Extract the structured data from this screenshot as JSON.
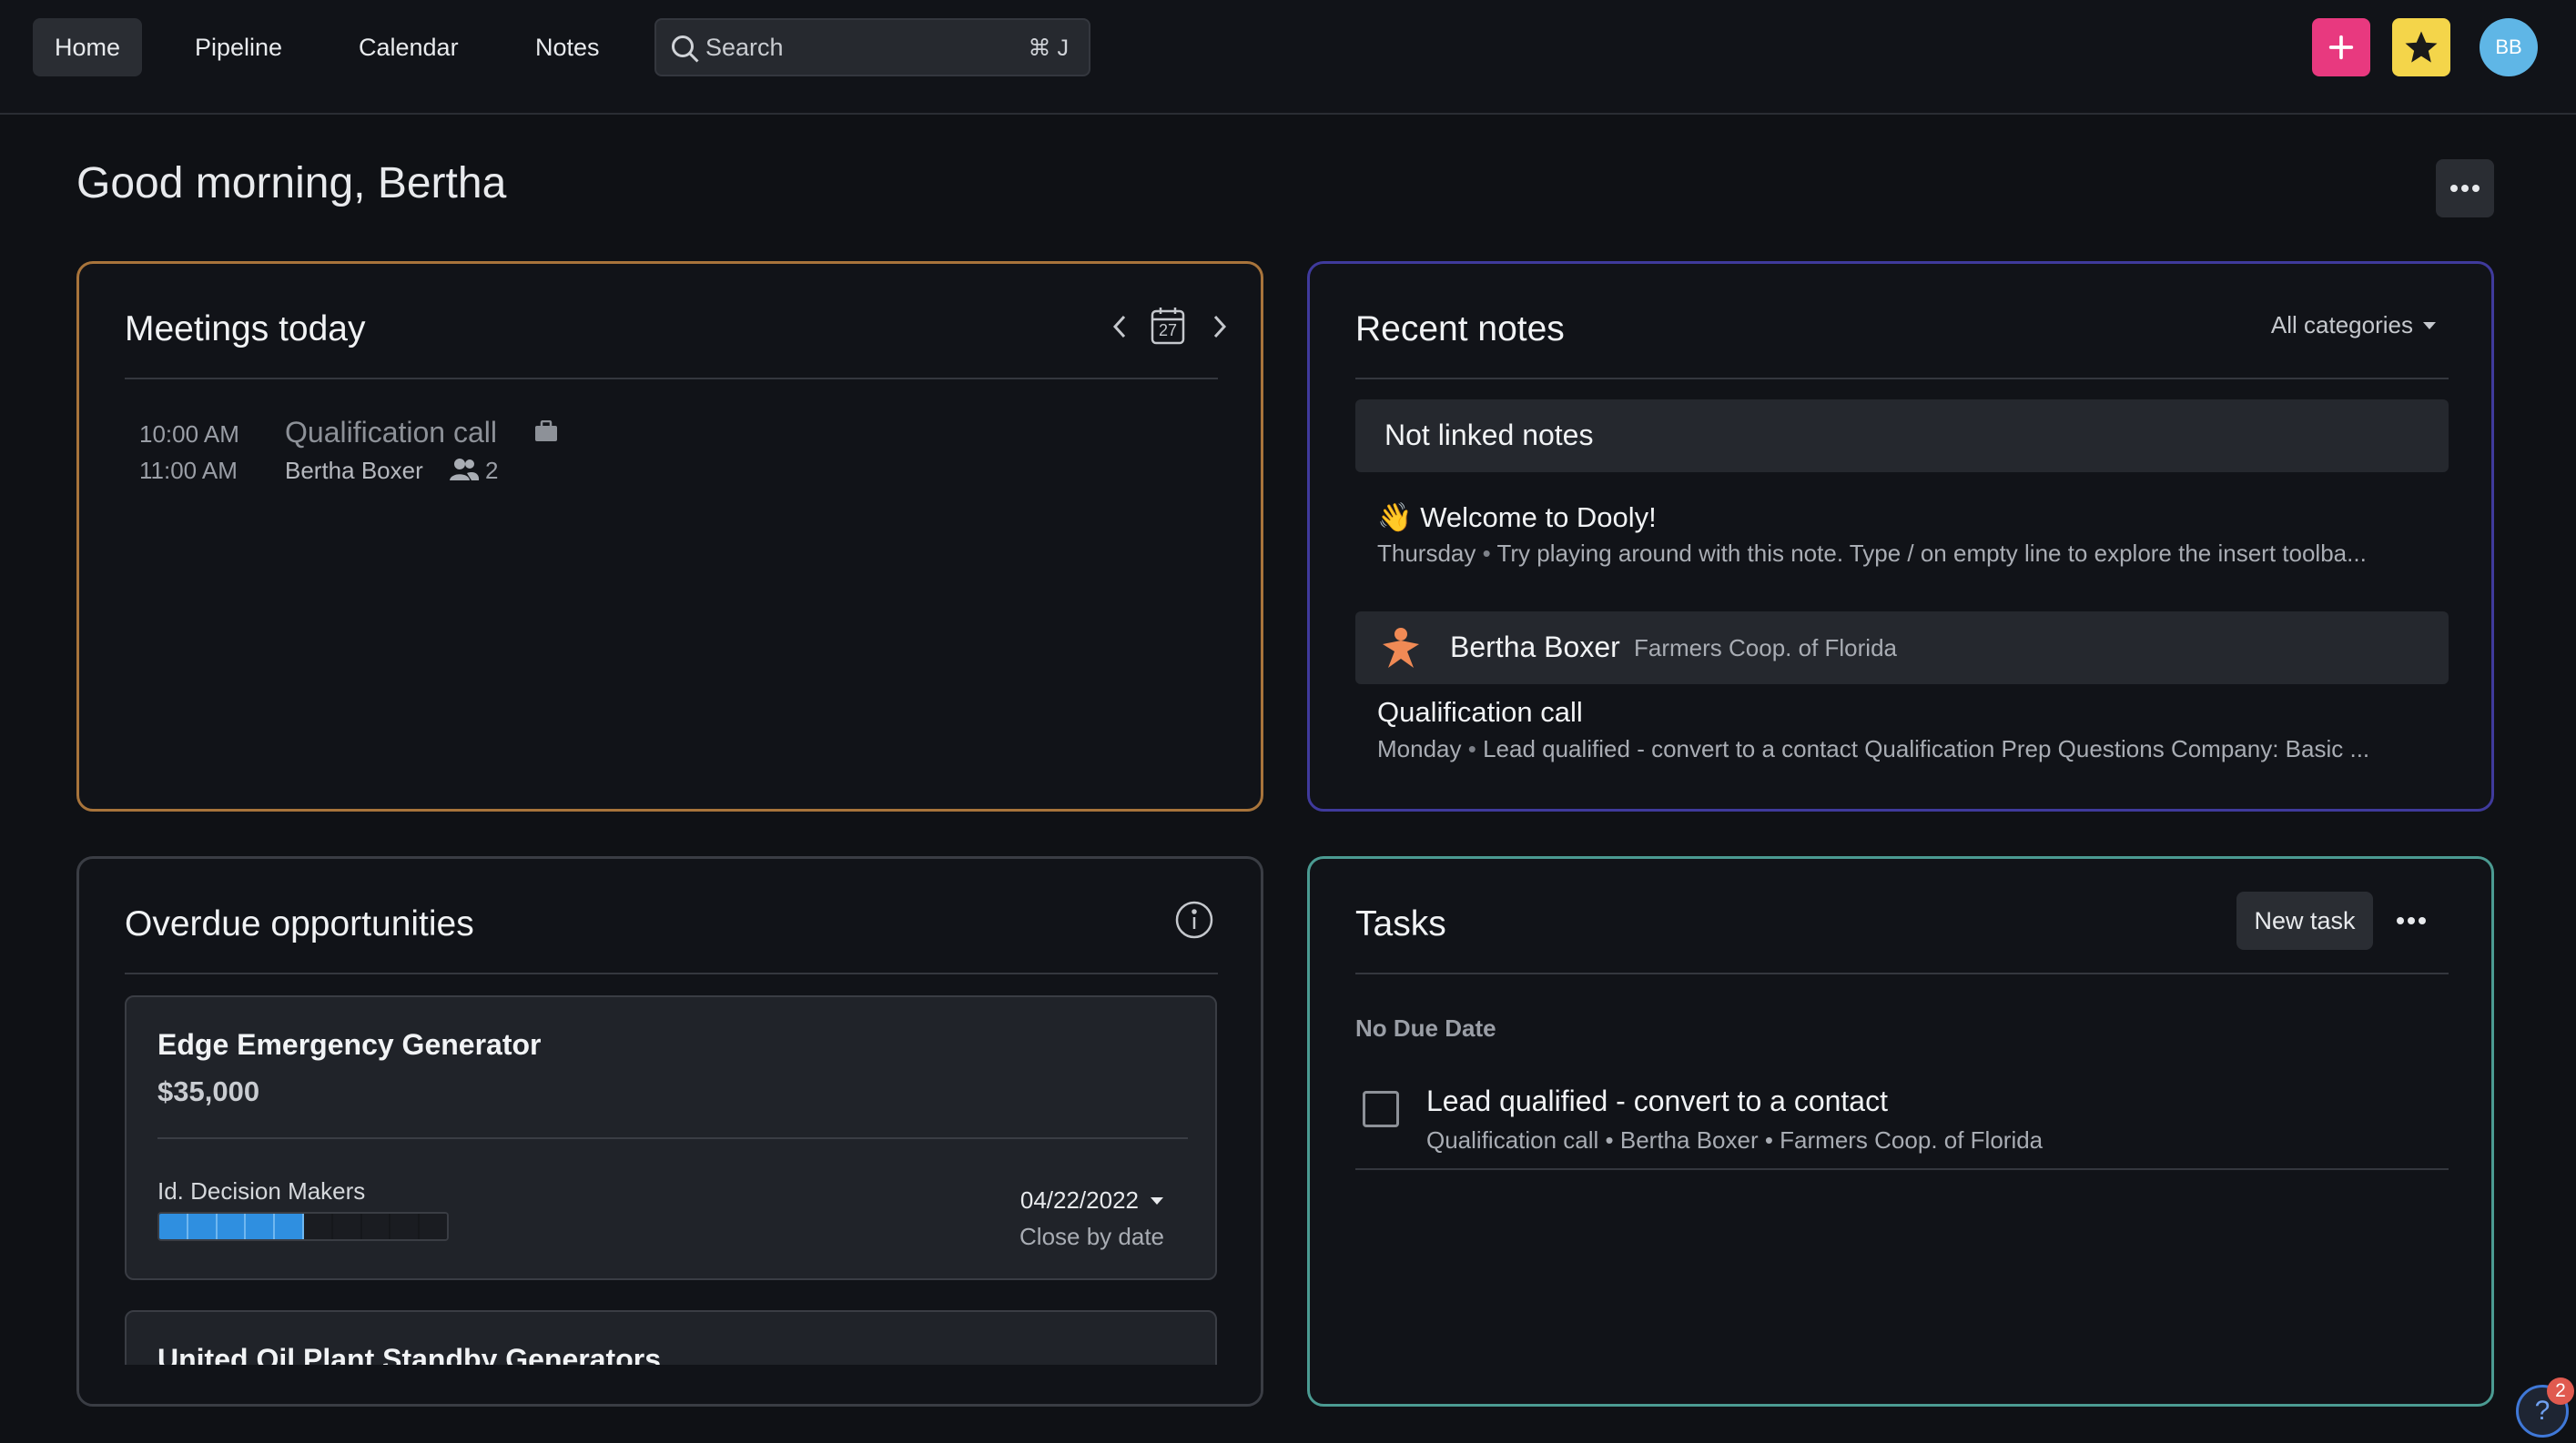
{
  "nav": {
    "items": [
      {
        "label": "Home",
        "active": true
      },
      {
        "label": "Pipeline"
      },
      {
        "label": "Calendar"
      },
      {
        "label": "Notes"
      }
    ],
    "search_placeholder": "Search",
    "search_shortcut": "⌘ J",
    "avatar_initials": "BB",
    "add_button_color": "#e8397f",
    "favorites_button_color": "#f4d54a"
  },
  "greeting": "Good morning, Bertha",
  "meetings": {
    "title": "Meetings today",
    "calendar_day": "27",
    "items": [
      {
        "start": "10:00 AM",
        "end": "11:00 AM",
        "title": "Qualification call",
        "person": "Bertha Boxer",
        "attendees": "2"
      }
    ]
  },
  "recent_notes": {
    "title": "Recent notes",
    "filter": "All categories",
    "groups": [
      {
        "header": "Not linked notes",
        "notes": [
          {
            "title": "👋 Welcome to Dooly!",
            "day": "Thursday",
            "preview": "Try playing around with this note. Type / on empty line to explore the insert toolba..."
          }
        ]
      },
      {
        "header": "Bertha Boxer",
        "company": "Farmers Coop. of Florida",
        "notes": [
          {
            "title": "Qualification call",
            "day": "Monday",
            "preview": "Lead qualified - convert to a contact Qualification Prep Questions Company: Basic ..."
          }
        ]
      }
    ]
  },
  "overdue": {
    "title": "Overdue opportunities",
    "opportunities": [
      {
        "name": "Edge Emergency Generator",
        "amount": "$35,000",
        "stage": "Id. Decision Makers",
        "stage_progress": 0.5,
        "stage_steps": 10,
        "date": "04/22/2022",
        "date_label": "Close by date"
      },
      {
        "name": "United Oil Plant Standby Generators"
      }
    ]
  },
  "tasks": {
    "title": "Tasks",
    "new_task_label": "New task",
    "section": "No Due Date",
    "items": [
      {
        "title": "Lead qualified - convert to a contact",
        "meta": "Qualification call • Bertha Boxer • Farmers Coop. of Florida"
      }
    ]
  },
  "help": {
    "badge": "2"
  },
  "colors": {
    "meetings_border": "#a8743b",
    "notes_border": "#3f3a9c",
    "overdue_border": "#3a3d44",
    "tasks_border": "#4b9b92",
    "progress_fill": "#2f8fe0"
  }
}
